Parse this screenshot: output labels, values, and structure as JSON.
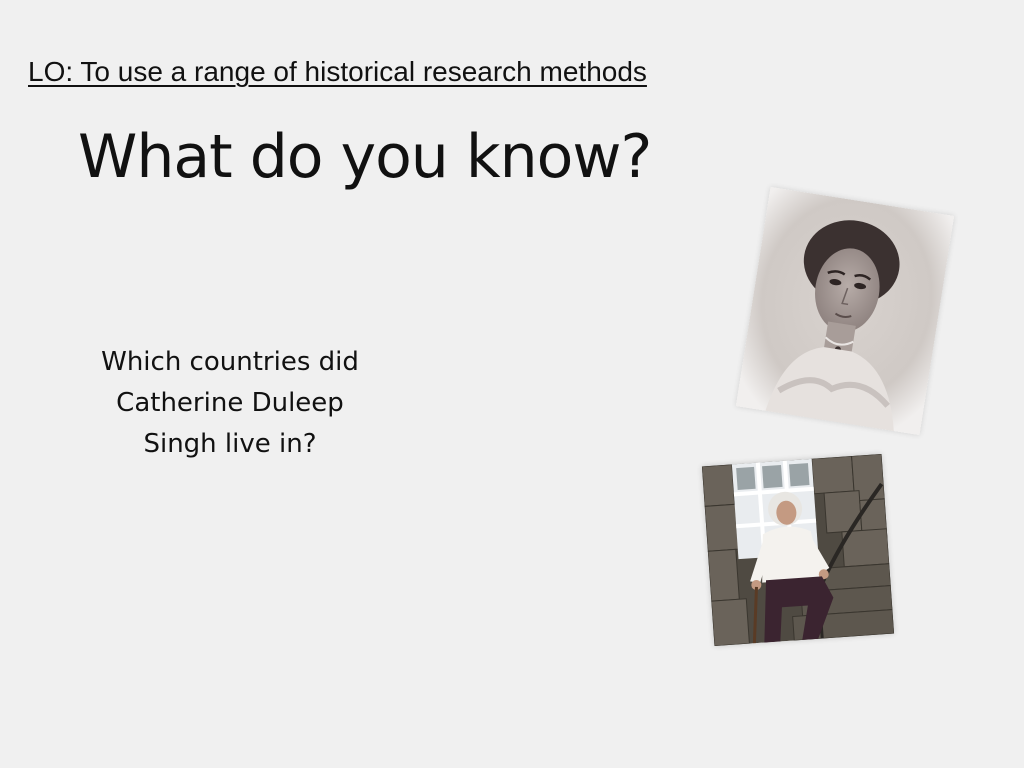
{
  "slide": {
    "objective": "LO: To use a range of historical research methods",
    "heading": "What do you know?",
    "question_lines": [
      "Which countries did",
      "Catherine Duleep",
      "Singh live in?"
    ]
  },
  "images": {
    "portrait": "sepia-portrait-young-woman",
    "elderly": "photo-elderly-woman-seated-on-stone-steps"
  },
  "colors": {
    "background": "#f0f0f0",
    "text": "#111111"
  }
}
